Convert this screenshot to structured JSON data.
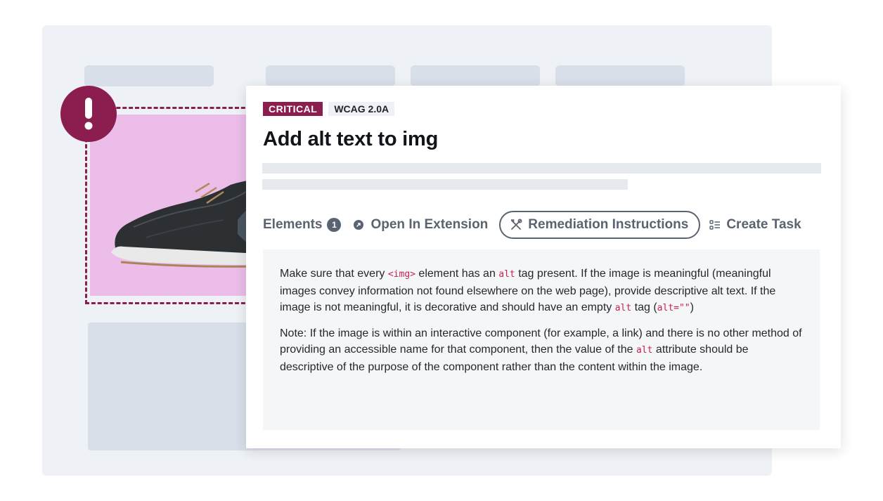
{
  "issue": {
    "severity": "CRITICAL",
    "standard": "WCAG 2.0A",
    "title": "Add alt text to img",
    "severity_color": "#8c1d4f"
  },
  "actions": {
    "elements_label": "Elements",
    "elements_count": "1",
    "open_extension_label": "Open In Extension",
    "remediation_label": "Remediation Instructions",
    "create_task_label": "Create Task"
  },
  "instructions": {
    "p1": {
      "t1": "Make sure that every ",
      "c1": "<img>",
      "t2": " element has an ",
      "c2": "alt",
      "t3": " tag present. If the image is meaningful (meaningful images convey information not found elsewhere on the web page), provide descriptive alt text. If the image is not meaningful, it is decorative and should have an empty ",
      "c3": "alt",
      "t4": " tag (",
      "c4": "alt=\"\"",
      "t5": ")"
    },
    "p2": {
      "t1": "Note: If the image is within an interactive component (for example, a link) and there is no other method of providing an accessible name for that component, then the value of the ",
      "c1": "alt",
      "t2": " attribute should be descriptive of the purpose of the component rather than the content within the image."
    }
  },
  "icons": {
    "alert": "exclamation-icon",
    "open_extension": "arrow-circle-icon",
    "remediation": "tools-icon",
    "create_task": "checklist-icon"
  },
  "colors": {
    "accent": "#8c1d4f",
    "code": "#c7234f",
    "image_background": "#ecbde9"
  }
}
